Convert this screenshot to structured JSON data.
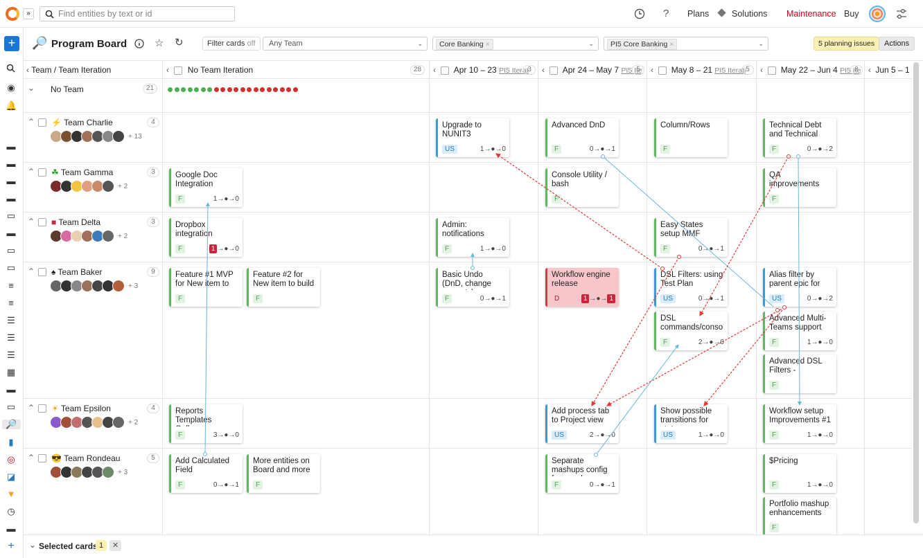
{
  "topbar": {
    "search_placeholder": "Find entities by text or id",
    "plans": "Plans",
    "solutions": "Solutions",
    "maintenance": "Maintenance",
    "buy": "Buy"
  },
  "board": {
    "title": "Program Board",
    "filter_cards": "Filter cards",
    "filter_state": "off",
    "team_filter": "Any Team",
    "project_chip": "Core Banking",
    "release_chip": "PI5 Core Banking",
    "planning_issues": "5 planning issues",
    "actions": "Actions"
  },
  "columns": {
    "team_header": "Team / Team Iteration",
    "c0": {
      "label": "No Team Iteration",
      "count": "28"
    },
    "c1": {
      "label": "Apr 10 – 23",
      "sub": "PI5 Iterat",
      "count": "3"
    },
    "c2": {
      "label": "Apr 24 – May 7",
      "sub": "PI5 Ite",
      "count": "5"
    },
    "c3": {
      "label": "May 8 – 21",
      "sub": "PI5 Iterati",
      "count": "5"
    },
    "c4": {
      "label": "May 22 – Jun 4",
      "sub": "PI5 Ite",
      "count": "8"
    },
    "c5": {
      "label": "Jun 5 – 1"
    }
  },
  "teams": {
    "none": {
      "name": "No Team",
      "count": "21"
    },
    "charlie": {
      "icon": "⚡",
      "name": "Team Charlie",
      "count": "4",
      "more": "+ 13"
    },
    "gamma": {
      "icon": "☘",
      "name": "Team Gamma",
      "count": "3",
      "more": "+ 2"
    },
    "delta": {
      "icon": "■",
      "name": "Team Delta",
      "count": "3",
      "more": "+ 2"
    },
    "baker": {
      "icon": "♠",
      "name": "Team Baker",
      "count": "9",
      "more": "+ 3"
    },
    "epsilon": {
      "icon": "☀",
      "name": "Team Epsilon",
      "count": "4",
      "more": "+ 2"
    },
    "rondeau": {
      "icon": "😎",
      "name": "Team Rondeau",
      "count": "5",
      "more": "+ 3"
    }
  },
  "cards": {
    "unit3": {
      "title": "Upgrade to NUNIT3",
      "tag": "US",
      "deps": "1→●→0"
    },
    "advdnd": {
      "title": "Advanced DnD",
      "tag": "F",
      "deps": "0→●→1"
    },
    "colrows": {
      "title": "Column/Rows",
      "tag": "F",
      "deps": ""
    },
    "techdebt": {
      "title": "Technical Debt and Technical",
      "tag": "F",
      "deps": "0→●→2"
    },
    "gdoc": {
      "title": "Google Doc Integration",
      "tag": "F",
      "deps": "1→●→0"
    },
    "console": {
      "title": "Console Utility / bash",
      "tag": "F",
      "deps": ""
    },
    "qa": {
      "title": "QA improvements",
      "tag": "F",
      "deps": ""
    },
    "dropbox": {
      "title": "Dropbox integration",
      "tag": "F",
      "badge": "1",
      "deps": "→●→0"
    },
    "admin": {
      "title": "Admin: notifications",
      "tag": "F",
      "deps": "1→●→0"
    },
    "easystates": {
      "title": "Easy States setup MMF",
      "tag": "F",
      "deps": "0→●→1"
    },
    "f1": {
      "title": "Feature #1 MVP for New item to",
      "tag": "F",
      "deps": ""
    },
    "f2": {
      "title": "Feature #2 for New item to build",
      "tag": "F",
      "deps": ""
    },
    "undo": {
      "title": "Basic Undo (DnD, change property)",
      "tag": "F",
      "deps": "0→●→1"
    },
    "workflow": {
      "title": "Workflow engine release",
      "tag": "D",
      "badge1": "1",
      "badge2": "1",
      "mid": "→●→"
    },
    "dslf": {
      "title": "DSL Filters: using Test Plan",
      "tag": "US",
      "deps": "0→●→1"
    },
    "alias": {
      "title": "Alias filter by parent epic for user",
      "tag": "US",
      "deps": "0→●→2"
    },
    "dslc": {
      "title": "DSL commands/console",
      "tag": "F",
      "deps": "2→●→0"
    },
    "multiteam": {
      "title": "Advanced Multi-Teams support",
      "tag": "F",
      "deps": "1→●→0"
    },
    "advdsl": {
      "title": "Advanced DSL Filters -",
      "tag": "F",
      "deps": ""
    },
    "reports": {
      "title": "Reports Templates Gallery",
      "tag": "F",
      "deps": "3→●→0"
    },
    "processtab": {
      "title": "Add process tab to Project view",
      "tag": "US",
      "deps": "2→●→0"
    },
    "transitions": {
      "title": "Show possible transitions for state",
      "tag": "US",
      "deps": "1→●→0"
    },
    "wfsetup": {
      "title": "Workflow setup Improvements #1",
      "tag": "F",
      "deps": "1→●→0"
    },
    "calcfield": {
      "title": "Add Calculated Field",
      "tag": "F",
      "deps": "0→●→1"
    },
    "moreent": {
      "title": "More entities on Board and more",
      "tag": "F",
      "deps": ""
    },
    "mashups": {
      "title": "Separate mashups config from code",
      "tag": "F",
      "deps": "0→●→1"
    },
    "pricing": {
      "title": "$Pricing",
      "tag": "F",
      "deps": "1→●→0"
    },
    "portfolio": {
      "title": "Portfolio mashup enhancements",
      "tag": "F",
      "deps": ""
    }
  },
  "footer": {
    "label": "Selected cards",
    "count": "1"
  },
  "colors": {
    "accent": "#d0021b",
    "link_blue": "#3a9ad9",
    "feature_green": "#5fb85f",
    "red_dep": "#e53935",
    "blue_dep": "#6cb6d9"
  }
}
